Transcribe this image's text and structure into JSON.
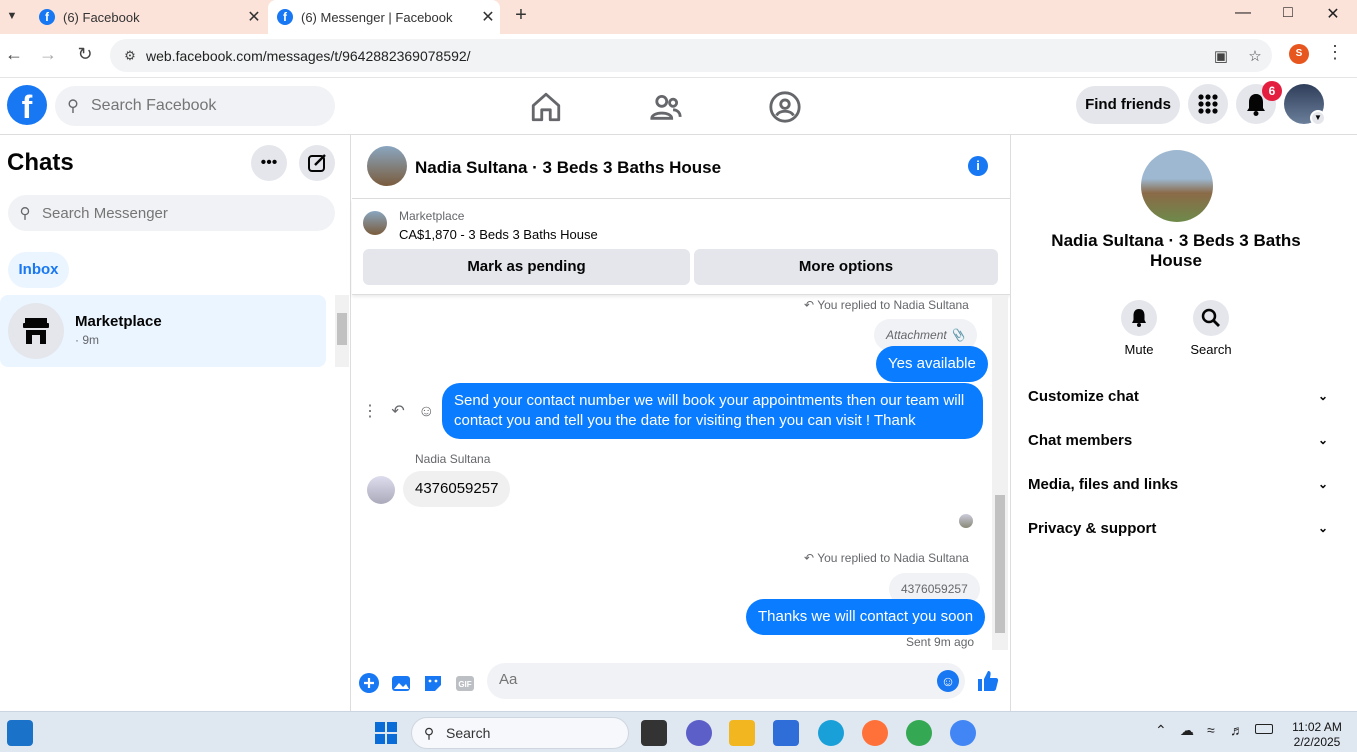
{
  "browser": {
    "tabs": [
      {
        "title": "(6) Facebook"
      },
      {
        "title": "(6) Messenger | Facebook"
      }
    ],
    "url": "web.facebook.com/messages/t/9642882369078592/",
    "profile_initial": "S"
  },
  "fb_header": {
    "search_placeholder": "Search Facebook",
    "find_friends": "Find friends",
    "notification_count": "6"
  },
  "left": {
    "title": "Chats",
    "search_placeholder": "Search Messenger",
    "filter_tab": "Inbox",
    "chats": [
      {
        "name": "Marketplace",
        "time": "· 9m"
      }
    ]
  },
  "conversation": {
    "title": "Nadia Sultana · 3 Beds 3 Baths House",
    "marketplace_label": "Marketplace",
    "listing": "CA$1,870 - 3 Beds 3 Baths House",
    "mark_pending": "Mark as pending",
    "more_options": "More options",
    "messages": {
      "replied_note_1": "You replied to Nadia Sultana",
      "attachment": "Attachment",
      "m1": "Yes available",
      "m2": "Send your contact number we will book your appointments then our team will contact you and tell you the date for visiting then you can visit ! Thank",
      "sender_name": "Nadia Sultana",
      "m3": "4376059257",
      "replied_note_2": "You replied to Nadia Sultana",
      "quoted": "4376059257",
      "m4": "Thanks we will contact you soon",
      "sent_status": "Sent 9m ago"
    },
    "composer_placeholder": "Aa"
  },
  "right": {
    "name": "Nadia Sultana · 3 Beds 3 Baths House",
    "actions": [
      {
        "label": "Mute"
      },
      {
        "label": "Search"
      }
    ],
    "sections": [
      {
        "label": "Customize chat"
      },
      {
        "label": "Chat members"
      },
      {
        "label": "Media, files and links"
      },
      {
        "label": "Privacy & support"
      }
    ]
  },
  "taskbar": {
    "search_label": "Search",
    "time": "11:02 AM",
    "date": "2/2/2025"
  },
  "colors": {
    "fb_blue": "#1877f2",
    "bubble_blue": "#0a7cff",
    "tab_strip": "#fce3da"
  }
}
